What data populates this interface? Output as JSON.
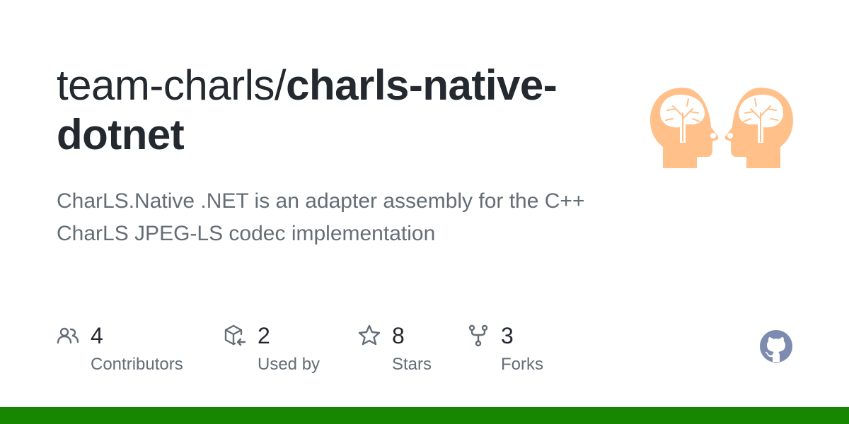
{
  "repo": {
    "owner": "team-charls/",
    "name": "charls-native-dotnet",
    "description": "CharLS.Native .NET is an adapter assembly for the C++ CharLS JPEG-LS codec implementation"
  },
  "stats": [
    {
      "icon": "people-icon",
      "value": "4",
      "label": "Contributors"
    },
    {
      "icon": "package-dependents-icon",
      "value": "2",
      "label": "Used by"
    },
    {
      "icon": "star-icon",
      "value": "8",
      "label": "Stars"
    },
    {
      "icon": "repo-forked-icon",
      "value": "3",
      "label": "Forks"
    }
  ],
  "colors": {
    "language_bar": "#178600",
    "hero_illustration": "#ffc08a",
    "github_logo": "#7d8bb0"
  }
}
